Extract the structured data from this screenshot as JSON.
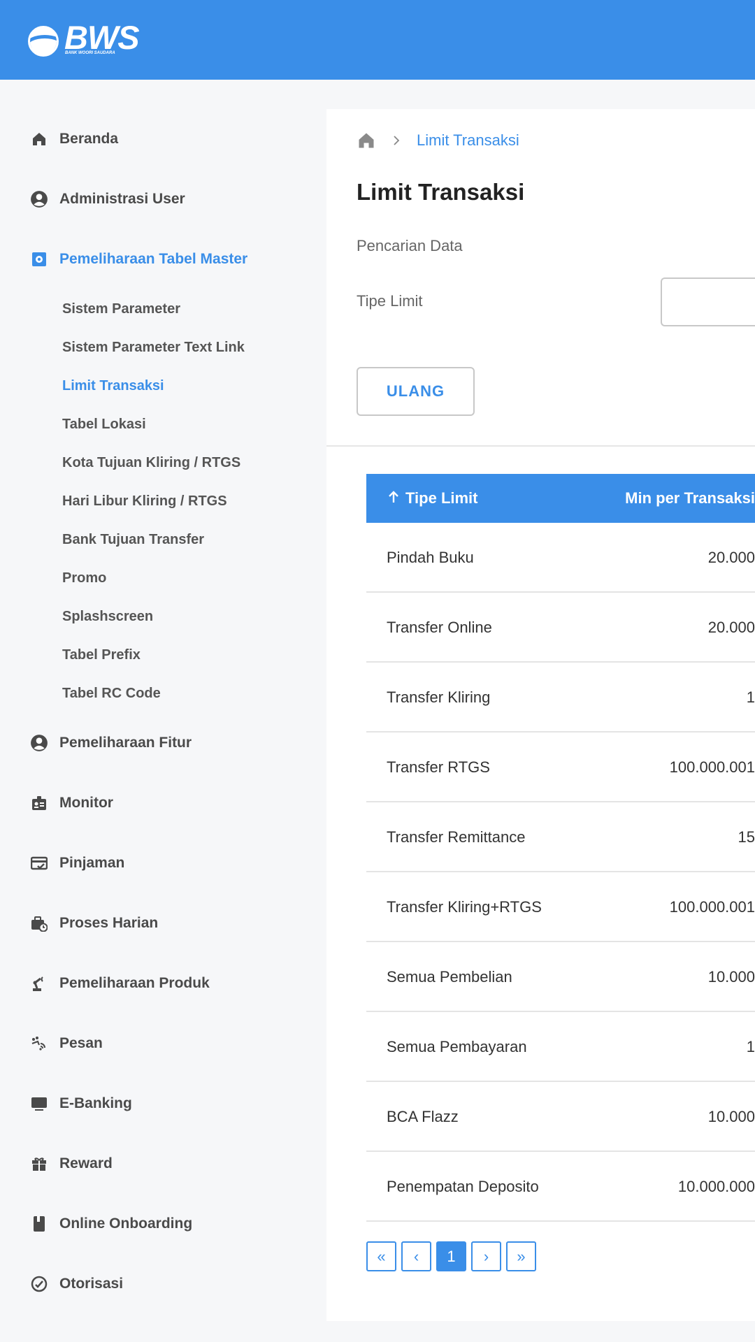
{
  "brand": {
    "name": "BWS",
    "tagline": "BANK WOORI SAUDARA",
    "color": "#3a8ee8"
  },
  "sidebar": {
    "items": [
      {
        "label": "Beranda",
        "icon": "home-icon"
      },
      {
        "label": "Administrasi User",
        "icon": "user-circle-icon"
      },
      {
        "label": "Pemeliharaan Tabel Master",
        "icon": "gear-icon",
        "active": true
      },
      {
        "label": "Pemeliharaan Fitur",
        "icon": "user-circle-icon"
      },
      {
        "label": "Monitor",
        "icon": "badge-icon"
      },
      {
        "label": "Pinjaman",
        "icon": "card-check-icon"
      },
      {
        "label": "Proses Harian",
        "icon": "briefcase-clock-icon"
      },
      {
        "label": "Pemeliharaan Produk",
        "icon": "robot-arm-icon"
      },
      {
        "label": "Pesan",
        "icon": "signal-icon"
      },
      {
        "label": "E-Banking",
        "icon": "monitor-icon"
      },
      {
        "label": "Reward",
        "icon": "gift-icon"
      },
      {
        "label": "Online Onboarding",
        "icon": "book-icon"
      },
      {
        "label": "Otorisasi",
        "icon": "approval-icon"
      }
    ],
    "subitems": [
      {
        "label": "Sistem Parameter"
      },
      {
        "label": "Sistem Parameter Text Link"
      },
      {
        "label": "Limit Transaksi",
        "active": true
      },
      {
        "label": "Tabel Lokasi"
      },
      {
        "label": "Kota Tujuan Kliring / RTGS"
      },
      {
        "label": "Hari Libur Kliring / RTGS"
      },
      {
        "label": "Bank Tujuan Transfer"
      },
      {
        "label": "Promo"
      },
      {
        "label": "Splashscreen"
      },
      {
        "label": "Tabel Prefix"
      },
      {
        "label": "Tabel RC Code"
      }
    ]
  },
  "breadcrumb": {
    "current": "Limit Transaksi"
  },
  "main": {
    "title": "Limit Transaksi",
    "search_label": "Pencarian Data",
    "filter_label": "Tipe Limit",
    "filter_value": "",
    "reset_label": "ULANG"
  },
  "table": {
    "columns": [
      "Tipe Limit",
      "Min per Transaksi"
    ],
    "sort_icon": "arrow-up-icon",
    "rows": [
      [
        "Pindah Buku",
        "20.000"
      ],
      [
        "Transfer Online",
        "20.000"
      ],
      [
        "Transfer Kliring",
        "1"
      ],
      [
        "Transfer RTGS",
        "100.000.001"
      ],
      [
        "Transfer Remittance",
        "15"
      ],
      [
        "Transfer Kliring+RTGS",
        "100.000.001"
      ],
      [
        "Semua Pembelian",
        "10.000"
      ],
      [
        "Semua Pembayaran",
        "1"
      ],
      [
        "BCA Flazz",
        "10.000"
      ],
      [
        "Penempatan Deposito",
        "10.000.000"
      ]
    ]
  },
  "pagination": {
    "first": "«",
    "prev": "‹",
    "current": "1",
    "next": "›",
    "last": "»"
  }
}
